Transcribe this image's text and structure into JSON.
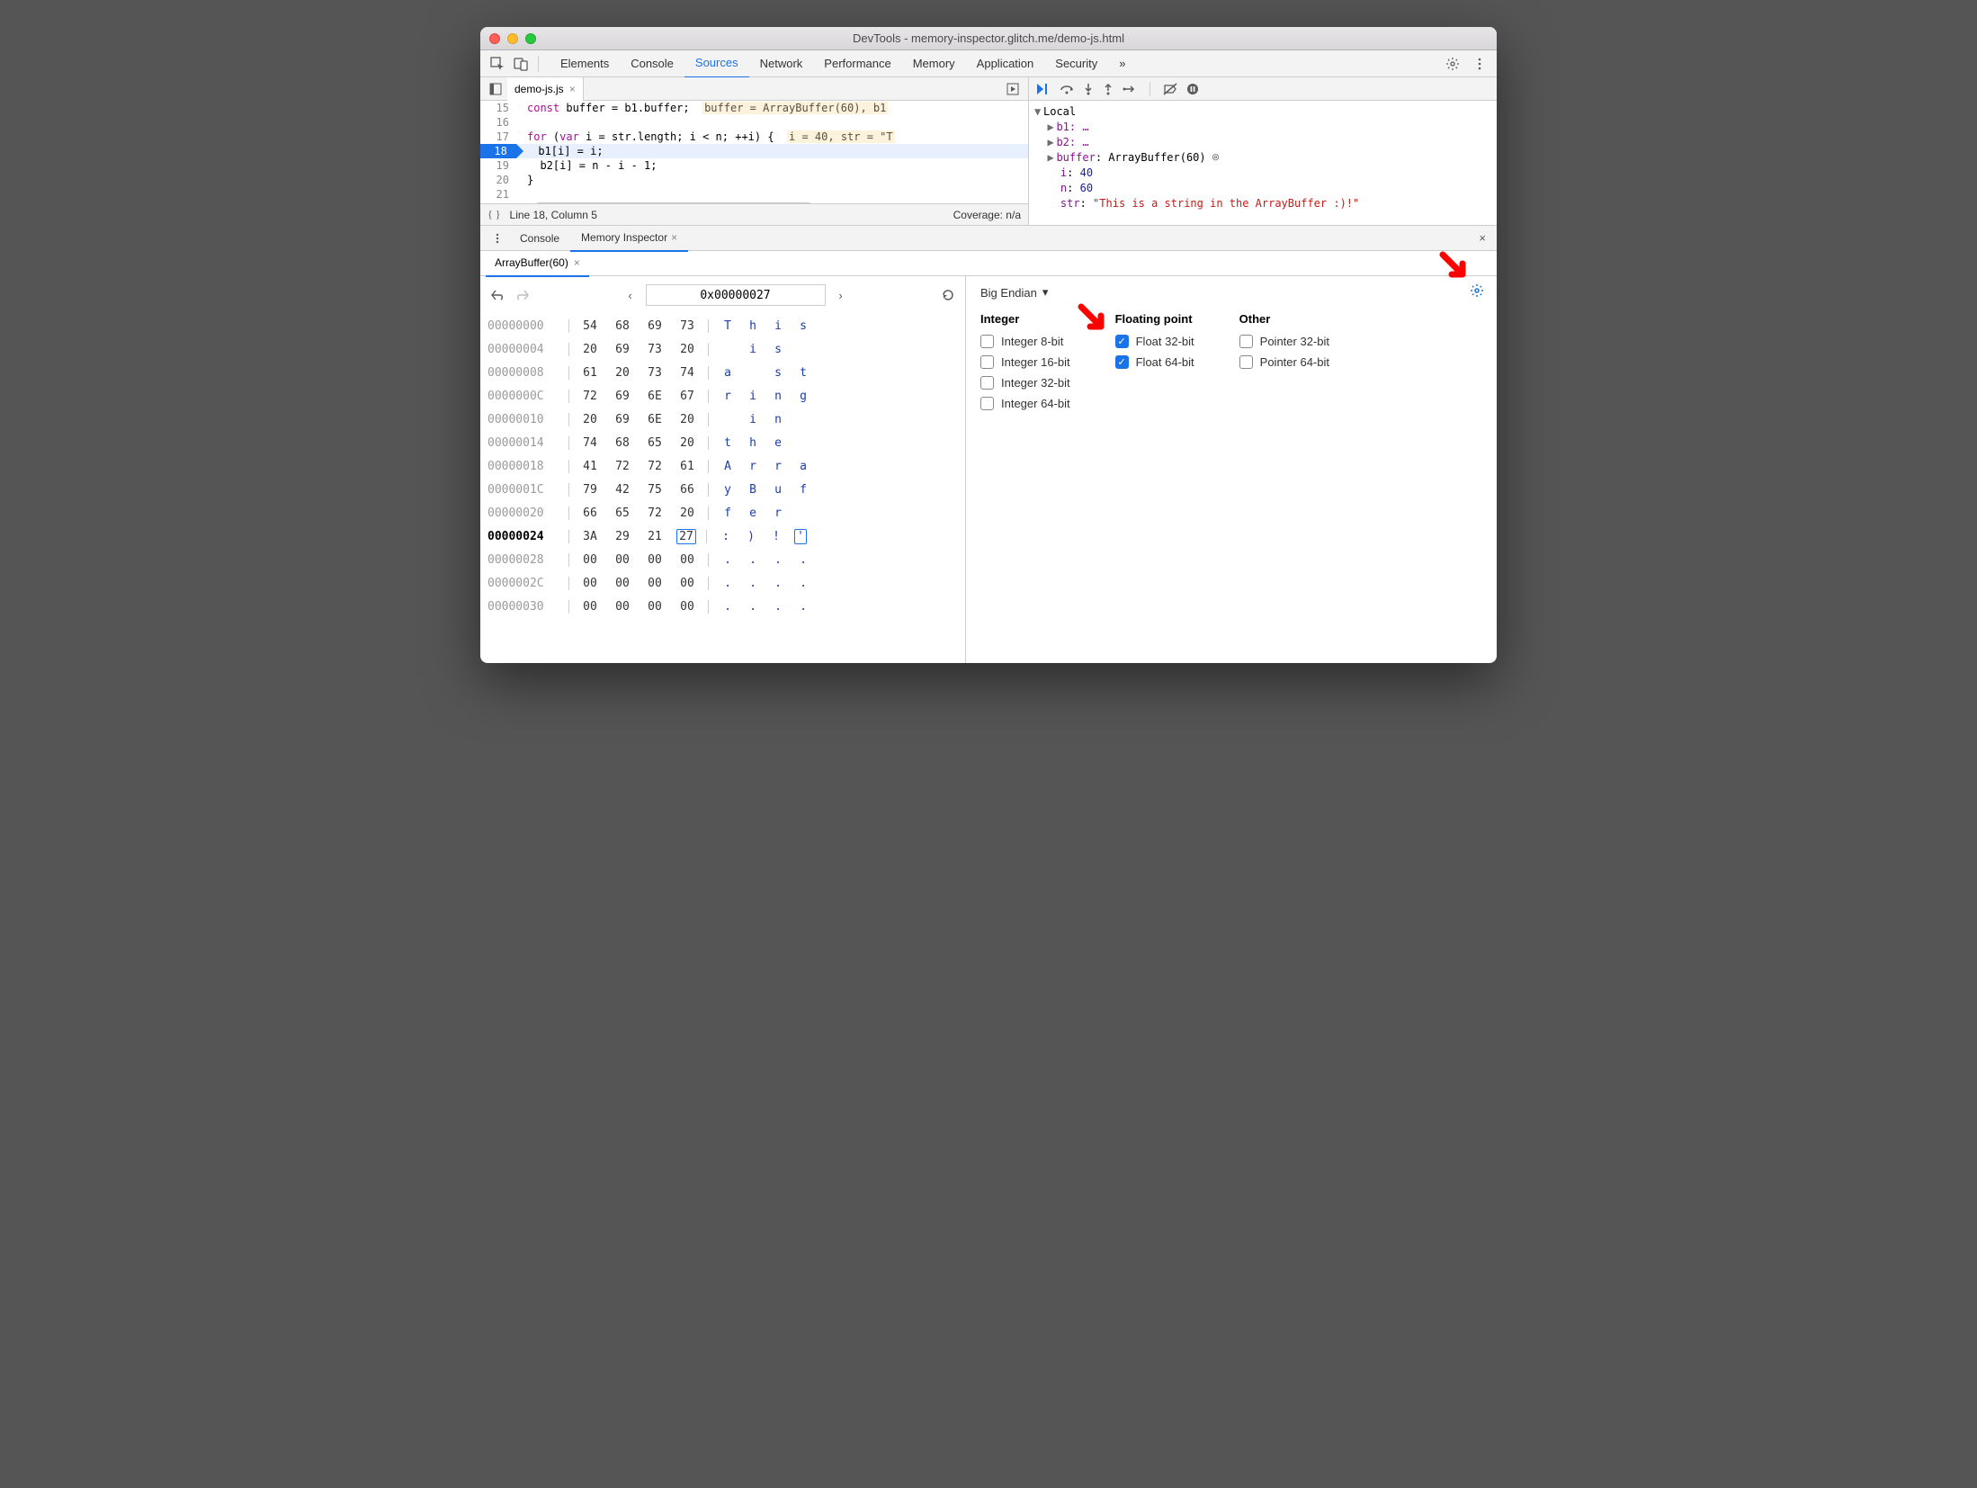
{
  "titlebar": {
    "title": "DevTools - memory-inspector.glitch.me/demo-js.html"
  },
  "topTabs": [
    "Elements",
    "Console",
    "Sources",
    "Network",
    "Performance",
    "Memory",
    "Application",
    "Security"
  ],
  "topTabActive": "Sources",
  "chevron": "»",
  "fileTab": {
    "name": "demo-js.js",
    "close": "×"
  },
  "code": {
    "l15": {
      "num": "15",
      "text": "const buffer = b1.buffer;",
      "hint": "buffer = ArrayBuffer(60), b1"
    },
    "l16": {
      "num": "16",
      "text": ""
    },
    "l17": {
      "num": "17",
      "text": "for (var i = str.length; i < n; ++i) {",
      "hint": "i = 40, str = \"T"
    },
    "l18": {
      "num": "18",
      "text": "  b1[i] = i;"
    },
    "l19": {
      "num": "19",
      "text": "  b2[i] = n - i - 1;"
    },
    "l20": {
      "num": "20",
      "text": "}"
    },
    "l21": {
      "num": "21",
      "text": ""
    }
  },
  "status": {
    "pos": "Line 18, Column 5",
    "cov": "Coverage: n/a"
  },
  "scope": {
    "title": "Local",
    "b1": "b1: …",
    "b2": "b2: …",
    "buf_k": "buffer",
    "buf_v": "ArrayBuffer(60)",
    "i_k": "i",
    "i_v": "40",
    "n_k": "n",
    "n_v": "60",
    "str_k": "str",
    "str_v": "\"This is a string in the ArrayBuffer :)!\""
  },
  "drawerTabs": {
    "console": "Console",
    "mi": "Memory Inspector",
    "close": "×"
  },
  "miTab": {
    "label": "ArrayBuffer(60)",
    "close": "×"
  },
  "miNav": {
    "address": "0x00000027"
  },
  "hex": {
    "rows": [
      {
        "addr": "00000000",
        "b": [
          "54",
          "68",
          "69",
          "73"
        ],
        "c": [
          "T",
          "h",
          "i",
          "s"
        ]
      },
      {
        "addr": "00000004",
        "b": [
          "20",
          "69",
          "73",
          "20"
        ],
        "c": [
          " ",
          "i",
          "s",
          " "
        ]
      },
      {
        "addr": "00000008",
        "b": [
          "61",
          "20",
          "73",
          "74"
        ],
        "c": [
          "a",
          " ",
          "s",
          "t"
        ]
      },
      {
        "addr": "0000000C",
        "b": [
          "72",
          "69",
          "6E",
          "67"
        ],
        "c": [
          "r",
          "i",
          "n",
          "g"
        ]
      },
      {
        "addr": "00000010",
        "b": [
          "20",
          "69",
          "6E",
          "20"
        ],
        "c": [
          " ",
          "i",
          "n",
          " "
        ]
      },
      {
        "addr": "00000014",
        "b": [
          "74",
          "68",
          "65",
          "20"
        ],
        "c": [
          "t",
          "h",
          "e",
          " "
        ]
      },
      {
        "addr": "00000018",
        "b": [
          "41",
          "72",
          "72",
          "61"
        ],
        "c": [
          "A",
          "r",
          "r",
          "a"
        ]
      },
      {
        "addr": "0000001C",
        "b": [
          "79",
          "42",
          "75",
          "66"
        ],
        "c": [
          "y",
          "B",
          "u",
          "f"
        ]
      },
      {
        "addr": "00000020",
        "b": [
          "66",
          "65",
          "72",
          "20"
        ],
        "c": [
          "f",
          "e",
          "r",
          " "
        ]
      },
      {
        "addr": "00000024",
        "b": [
          "3A",
          "29",
          "21",
          "27"
        ],
        "c": [
          ":",
          ")",
          "!",
          "'"
        ],
        "cur": true,
        "sel": 3
      },
      {
        "addr": "00000028",
        "b": [
          "00",
          "00",
          "00",
          "00"
        ],
        "c": [
          ".",
          ".",
          ".",
          "."
        ]
      },
      {
        "addr": "0000002C",
        "b": [
          "00",
          "00",
          "00",
          "00"
        ],
        "c": [
          ".",
          ".",
          ".",
          "."
        ]
      },
      {
        "addr": "00000030",
        "b": [
          "00",
          "00",
          "00",
          "00"
        ],
        "c": [
          ".",
          ".",
          ".",
          "."
        ]
      }
    ]
  },
  "endian": {
    "label": "Big Endian"
  },
  "sections": {
    "integer": {
      "title": "Integer",
      "opts": [
        "Integer 8-bit",
        "Integer 16-bit",
        "Integer 32-bit",
        "Integer 64-bit"
      ],
      "checked": []
    },
    "float": {
      "title": "Floating point",
      "opts": [
        "Float 32-bit",
        "Float 64-bit"
      ],
      "checked": [
        0,
        1
      ]
    },
    "other": {
      "title": "Other",
      "opts": [
        "Pointer 32-bit",
        "Pointer 64-bit"
      ],
      "checked": []
    }
  }
}
